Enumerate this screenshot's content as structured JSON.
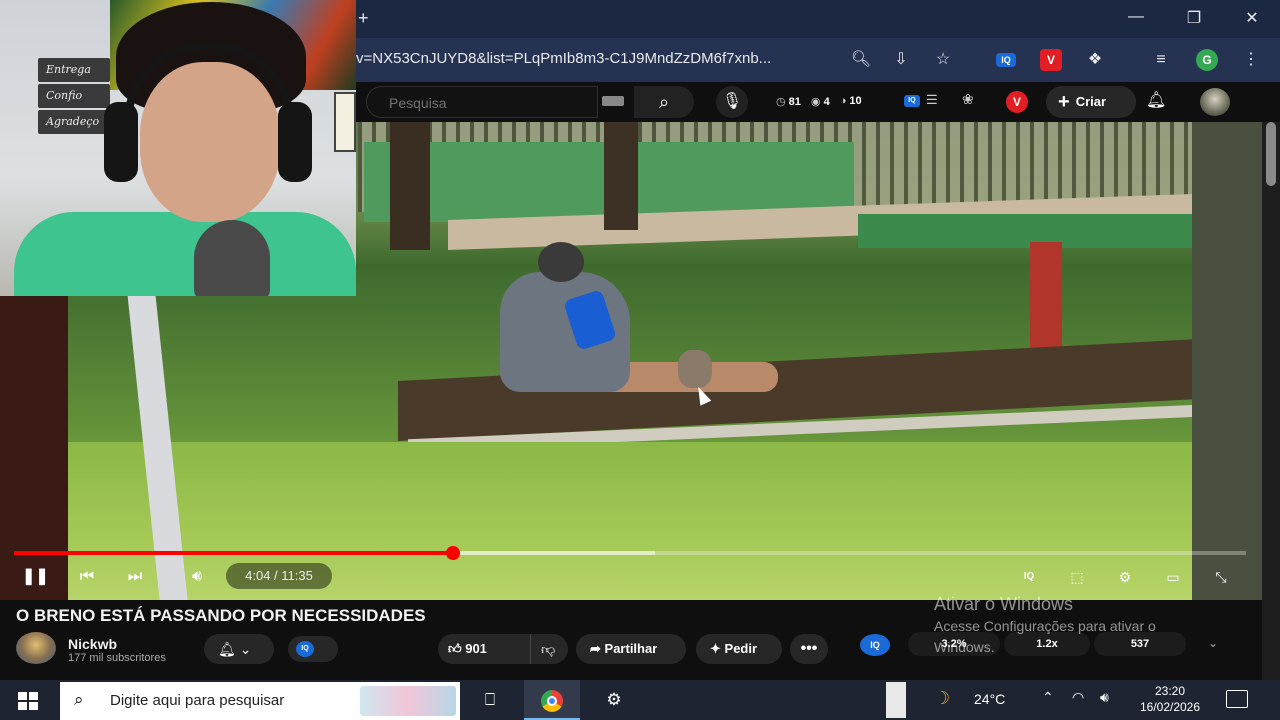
{
  "browser": {
    "new_tab": "+",
    "url": "v=NX53CnJUYD8&list=PLqPmIb8m3-C1J9MndZzDM6f7xnb...",
    "window_controls": {
      "minimize": "—",
      "maximize": "❐",
      "close": "✕"
    },
    "toolbar_icons": [
      "zoom-icon",
      "install-icon",
      "bookmark-star-icon",
      "iq-extension-icon",
      "v-extension-icon",
      "extensions-puzzle-icon",
      "media-control-icon",
      "profile-avatar-icon",
      "menu-dots-icon"
    ],
    "extension_iq": "IQ",
    "extension_v": "V",
    "profile_initial": "G",
    "menu": "⋮"
  },
  "youtube_header": {
    "search_placeholder": "Pesquisa",
    "stats": [
      {
        "icon": "clock-icon",
        "value": "81"
      },
      {
        "icon": "eye-icon",
        "value": "4"
      },
      {
        "icon": "users-icon",
        "value": "10"
      }
    ],
    "iq": "IQ",
    "v": "V",
    "create_label": "Criar"
  },
  "player": {
    "progress_played": 0.3567,
    "progress_loaded": 0.52,
    "time": "4:04 / 11:35",
    "right_controls": [
      "iq-icon",
      "subtitles-icon",
      "settings-icon",
      "miniplayer-icon",
      "fullscreen-icon"
    ],
    "iq": "IQ"
  },
  "video": {
    "title": "O BRENO ESTÁ PASSANDO POR NECESSIDADES",
    "channel": "Nickwb",
    "subscribers": "177 mil subscritores",
    "likes": "901",
    "share_label": "Partilhar",
    "ask_label": "Pedir",
    "more": "•••",
    "iq": "IQ",
    "iq_stats": [
      "3.2%",
      "1.2x",
      "537"
    ]
  },
  "watermark": {
    "title": "Ativar o Windows",
    "line1": "Acesse Configurações para ativar o",
    "line2": "Windows."
  },
  "webcam": {
    "signs": [
      "Entrega",
      "Confio",
      "Agradeço"
    ]
  },
  "taskbar": {
    "search_placeholder": "Digite aqui para pesquisar",
    "temperature": "24°C",
    "time": "23:20",
    "date": "16/02/2026"
  },
  "colors": {
    "accent_red": "#ff0000",
    "chrome_bar": "#1c2841",
    "iq_blue": "#1a6bd8"
  }
}
